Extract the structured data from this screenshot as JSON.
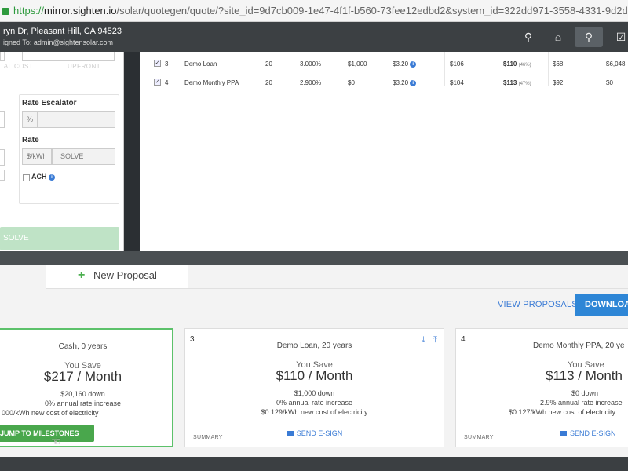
{
  "browser": {
    "url_protocol": "https://",
    "url_host": "mirror.sighten.io",
    "url_path": "/solar/quotegen/quote/?site_id=9d7cb009-1e47-4f1f-b560-73fee12edbd2&system_id=322dd971-3558-4331-9d2d-8"
  },
  "header": {
    "address": "ryn Dr, Pleasant Hill, CA 94523",
    "assigned": "igned To: admin@sightensolar.com",
    "icons": [
      "map-pin-icon",
      "home-icon",
      "tag-icon",
      "checkbox-icon"
    ]
  },
  "left_panel": {
    "faint_label_1": "TAL COST",
    "faint_label_2": "UPFRONT",
    "rate_escalator_label": "Rate Escalator",
    "percent_unit": "%",
    "rate_label": "Rate",
    "rate_unit": "$/kWh",
    "rate_solve": "SOLVE",
    "ach_label": "ACH",
    "solve_button": "SOLVE"
  },
  "table": {
    "rows": [
      {
        "num": "3",
        "name": "Demo Loan",
        "term": "20",
        "rate": "3.000%",
        "down": "$1,000",
        "ppw": "$3.20",
        "c1": "$106",
        "c2": "$110",
        "c2pct": "(46%)",
        "c3": "$68",
        "c4": "$6,048"
      },
      {
        "num": "4",
        "name": "Demo Monthly PPA",
        "term": "20",
        "rate": "2.900%",
        "down": "$0",
        "ppw": "$3.20",
        "c1": "$104",
        "c2": "$113",
        "c2pct": "(47%)",
        "c3": "$92",
        "c4": "$0"
      }
    ]
  },
  "proposals": {
    "new_proposal": "New Proposal",
    "view_proposals": "VIEW PROPOSALS",
    "download": "DOWNLOA"
  },
  "cards": [
    {
      "num": "",
      "title": "Cash, 0 years",
      "you_save": "You Save",
      "amount": "$217 / Month",
      "line1": "$20,160 down",
      "line2": "0% annual rate increase",
      "line3": "000/kWh new cost of electricity",
      "button": "JUMP TO MILESTONES"
    },
    {
      "num": "3",
      "title": "Demo Loan, 20 years",
      "you_save": "You Save",
      "amount": "$110 / Month",
      "line1": "$1,000 down",
      "line2": "0% annual rate increase",
      "line3": "$0.129/kWh new cost of electricity",
      "summary": "SUMMARY",
      "esign": "SEND E-SIGN"
    },
    {
      "num": "4",
      "title": "Demo Monthly PPA, 20 ye",
      "you_save": "You Save",
      "amount": "$113 / Month",
      "line1": "$0 down",
      "line2": "2.9% annual rate increase",
      "line3": "$0.127/kWh new cost of electricity",
      "summary": "SUMMARY",
      "esign": "SEND E-SIGN"
    }
  ],
  "colors": {
    "accent_blue": "#2e86d6",
    "accent_green": "#49a74c",
    "header_bg": "#3c4043"
  }
}
